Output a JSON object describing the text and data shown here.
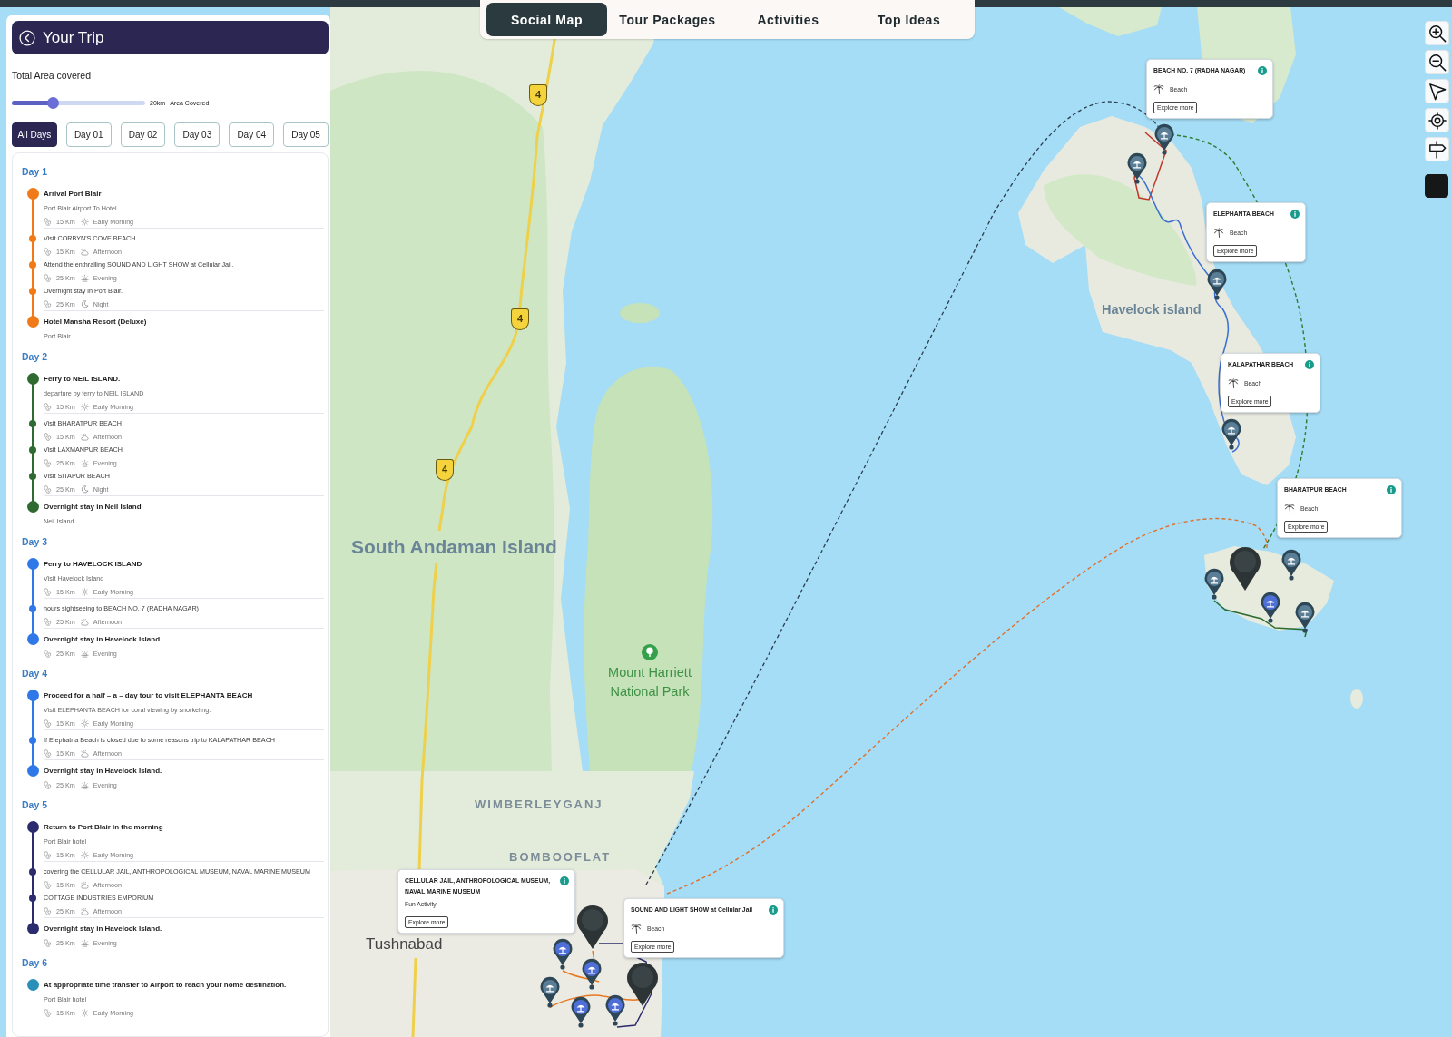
{
  "top_nav": {
    "tabs": [
      {
        "label": "Social Map",
        "selected": true
      },
      {
        "label": "Tour Packages",
        "selected": false
      },
      {
        "label": "Activities",
        "selected": false
      },
      {
        "label": "Top Ideas",
        "selected": false
      }
    ]
  },
  "trip_panel": {
    "title": "Your Trip",
    "area_label": "Total Area covered",
    "area_slider": {
      "level": 0.31,
      "value": "20km",
      "caption": "Area Covered"
    },
    "day_filters": [
      {
        "label": "All Days",
        "selected": true
      },
      {
        "label": "Day 01",
        "selected": false
      },
      {
        "label": "Day 02",
        "selected": false
      },
      {
        "label": "Day 03",
        "selected": false
      },
      {
        "label": "Day 04",
        "selected": false
      },
      {
        "label": "Day 05",
        "selected": false
      }
    ],
    "days": [
      {
        "heading": "Day 1",
        "color": "#f07a17",
        "stops": [
          {
            "kind": "major",
            "title": "Arrival Port Blair",
            "note": "Port Blair Airport To Hotel.",
            "meta": {
              "kind": "morning",
              "distance": "15 Km",
              "time": "Early Morning"
            }
          },
          {
            "kind": "minor",
            "title": "Visit CORBYN'S COVE BEACH.",
            "meta": {
              "kind": "afternoon",
              "distance": "15 Km",
              "time": "Afternoon"
            }
          },
          {
            "kind": "minor",
            "title": "Attend the enthralling SOUND AND LIGHT SHOW at Cellular Jail.",
            "meta": {
              "kind": "evening",
              "distance": "25 Km",
              "time": "Evening"
            }
          },
          {
            "kind": "minor",
            "title": "Overnight stay in Port Blair.",
            "meta": {
              "kind": "night",
              "distance": "25 Km",
              "time": "Night"
            }
          },
          {
            "kind": "major",
            "title": "Hotel Mansha Resort (Deluxe)",
            "note": "Port Blair"
          }
        ]
      },
      {
        "heading": "Day 2",
        "color": "#2f6b31",
        "stops": [
          {
            "kind": "major",
            "title": "Ferry to NEIL ISLAND.",
            "note": "departure by ferry to NEIL ISLAND",
            "meta": {
              "kind": "morning",
              "distance": "15 Km",
              "time": "Early Morning"
            }
          },
          {
            "kind": "minor",
            "title": "Visit BHARATPUR BEACH",
            "meta": {
              "kind": "afternoon",
              "distance": "15 Km",
              "time": "Afternoon"
            }
          },
          {
            "kind": "minor",
            "title": "Visit LAXMANPUR BEACH",
            "meta": {
              "kind": "evening",
              "distance": "25 Km",
              "time": "Evening"
            }
          },
          {
            "kind": "minor",
            "title": "Visit SITAPUR BEACH",
            "meta": {
              "kind": "night",
              "distance": "25 Km",
              "time": "Night"
            }
          },
          {
            "kind": "major",
            "title": "Overnight stay in Neil Island",
            "note": "Neil Island"
          }
        ]
      },
      {
        "heading": "Day 3",
        "color": "#2f78e8",
        "stops": [
          {
            "kind": "major",
            "title": "Ferry to HAVELOCK ISLAND",
            "note": "Visit Havelock Island",
            "meta": {
              "kind": "morning",
              "distance": "15 Km",
              "time": "Early Morning"
            }
          },
          {
            "kind": "minor",
            "title": "hours sightseeing to BEACH NO. 7 (RADHA NAGAR)",
            "meta": {
              "kind": "afternoon",
              "distance": "25 Km",
              "time": "Afternoon"
            }
          },
          {
            "kind": "major",
            "title": "Overnight stay in Havelock Island.",
            "meta": {
              "kind": "evening",
              "distance": "25 Km",
              "time": "Evening"
            }
          }
        ]
      },
      {
        "heading": "Day 4",
        "color": "#2f78e8",
        "stops": [
          {
            "kind": "major",
            "title": "Proceed for a half – a – day tour to visit ELEPHANTA BEACH",
            "note": "Visit ELEPHANTA BEACH for coral viewing by snorkeling.",
            "meta": {
              "kind": "morning",
              "distance": "15 Km",
              "time": "Early Morning"
            }
          },
          {
            "kind": "minor",
            "title": "If Elephatna Beach is closed due to some reasons trip to KALAPATHAR BEACH",
            "meta": {
              "kind": "afternoon",
              "distance": "15 Km",
              "time": "Afternoon"
            }
          },
          {
            "kind": "major",
            "title": "Overnight stay in Havelock Island.",
            "meta": {
              "kind": "evening",
              "distance": "25 Km",
              "time": "Evening"
            }
          }
        ]
      },
      {
        "heading": "Day 5",
        "color": "#2b2c6e",
        "stops": [
          {
            "kind": "major",
            "title": "Return to Port Blair in the morning",
            "note": "Port Blair hotel",
            "meta": {
              "kind": "morning",
              "distance": "15 Km",
              "time": "Early Morning"
            }
          },
          {
            "kind": "minor",
            "title": "covering the CELLULAR JAIL, ANTHROPOLOGICAL MUSEUM, NAVAL MARINE MUSEUM",
            "meta": {
              "kind": "afternoon",
              "distance": "15 Km",
              "time": "Afternoon"
            }
          },
          {
            "kind": "minor",
            "title": "COTTAGE INDUSTRIES EMPORIUM",
            "meta": {
              "kind": "afternoon",
              "distance": "25 Km",
              "time": "Afternoon"
            }
          },
          {
            "kind": "major",
            "title": "Overnight stay in Havelock Island.",
            "meta": {
              "kind": "evening",
              "distance": "25 Km",
              "time": "Evening"
            }
          }
        ]
      },
      {
        "heading": "Day 6",
        "color": "#2a90b8",
        "stops": [
          {
            "kind": "major",
            "title": "At appropriate time transfer to Airport to reach your home destination.",
            "note": "Port Blair hotel",
            "meta": {
              "kind": "morning",
              "distance": "15 Km",
              "time": "Early Morning"
            }
          }
        ]
      }
    ]
  },
  "map": {
    "labels": [
      {
        "kind": "island",
        "text": "South Andaman Island"
      },
      {
        "kind": "island",
        "text": "Havelock island"
      },
      {
        "kind": "park",
        "text": "Mount Harriett National Park"
      },
      {
        "kind": "area",
        "text": "WIMBERLEYGANJ"
      },
      {
        "kind": "area",
        "text": "BOMBOOFLAT"
      },
      {
        "kind": "town",
        "text": "Tushnabad"
      }
    ],
    "road_shields": [
      {
        "label": "4"
      },
      {
        "label": "4"
      },
      {
        "label": "4"
      }
    ],
    "places": [
      {
        "kind": "beach",
        "name": "BEACH NO. 7 (RADHA NAGAR)",
        "category": "Beach",
        "action": "Explore more"
      },
      {
        "kind": "beach",
        "name": "ELEPHANTA BEACH",
        "category": "Beach",
        "action": "Explore more"
      },
      {
        "kind": "beach",
        "name": "KALAPATHAR BEACH",
        "category": "Beach",
        "action": "Explore more"
      },
      {
        "kind": "beach",
        "name": "BHARATPUR BEACH",
        "category": "Beach",
        "action": "Explore more"
      },
      {
        "kind": "activity",
        "name": "CELLULAR JAIL, ANTHROPOLOGICAL MUSEUM, NAVAL MARINE MUSEUM",
        "category": "Fun Activity",
        "action": "Explore more"
      },
      {
        "kind": "beach",
        "name": "SOUND AND LIGHT SHOW at Cellular Jail",
        "category": "Beach",
        "action": "Explore more"
      }
    ]
  }
}
